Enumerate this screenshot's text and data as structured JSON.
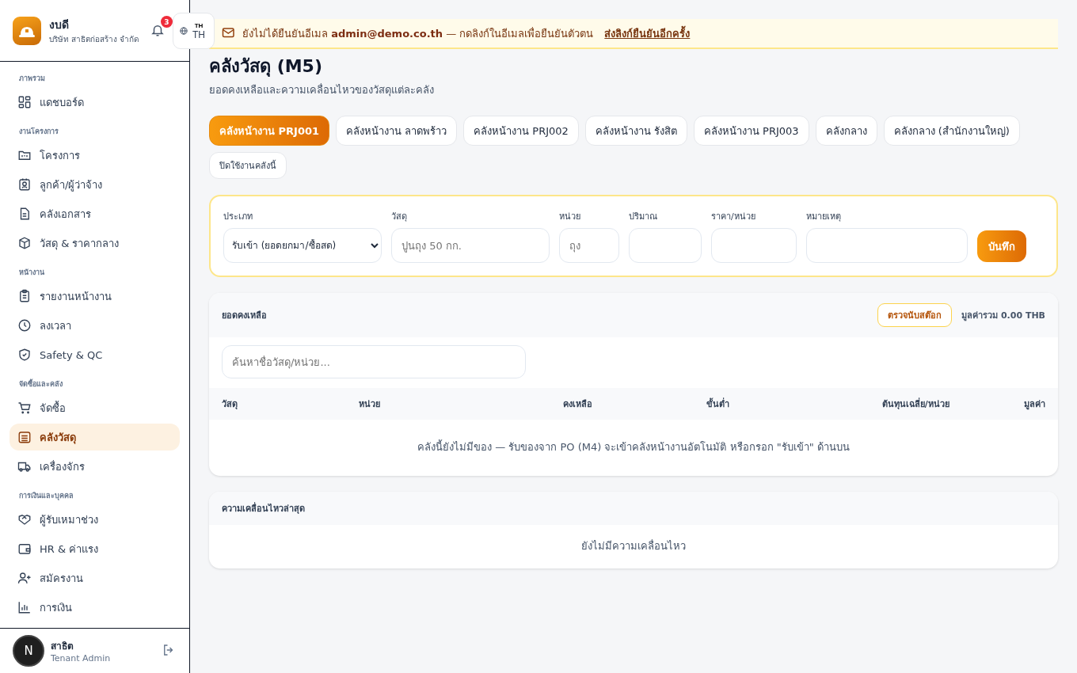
{
  "brand": {
    "name": "งบดี",
    "company": "บริษัท สาธิตก่อสร้าง จำกัด"
  },
  "notifications": {
    "count": "3"
  },
  "language": {
    "small": "TH",
    "label": "TH"
  },
  "sidebar": {
    "sections": [
      {
        "title": "ภาพรวม",
        "items": [
          {
            "label": "แดชบอร์ด",
            "selected": false
          }
        ]
      },
      {
        "title": "งานโครงการ",
        "items": [
          {
            "label": "โครงการ",
            "selected": false
          },
          {
            "label": "ลูกค้า/ผู้ว่าจ้าง",
            "selected": false
          },
          {
            "label": "คลังเอกสาร",
            "selected": false
          },
          {
            "label": "วัสดุ & ราคากลาง",
            "selected": false
          }
        ]
      },
      {
        "title": "หน้างาน",
        "items": [
          {
            "label": "รายงานหน้างาน",
            "selected": false
          },
          {
            "label": "ลงเวลา",
            "selected": false
          },
          {
            "label": "Safety & QC",
            "selected": false
          }
        ]
      },
      {
        "title": "จัดซื้อและคลัง",
        "items": [
          {
            "label": "จัดซื้อ",
            "selected": false
          },
          {
            "label": "คลังวัสดุ",
            "selected": true
          },
          {
            "label": "เครื่องจักร",
            "selected": false
          }
        ]
      },
      {
        "title": "การเงินและบุคคล",
        "items": [
          {
            "label": "ผู้รับเหมาช่วง",
            "selected": false
          },
          {
            "label": "HR & ค่าแรง",
            "selected": false
          },
          {
            "label": "สมัครงาน",
            "selected": false
          },
          {
            "label": "การเงิน",
            "selected": false
          }
        ]
      }
    ]
  },
  "user": {
    "avatar": "N",
    "name": "สาธิต",
    "role": "Tenant Admin"
  },
  "banner": {
    "message": "ยังไม่ได้ยืนยันอีเมล **admin@demo.co.th** — กดลิงก์ในอีเมลเพื่อยืนยันตัวตน",
    "link": "ส่งลิงก์ยืนยันอีกครั้ง"
  },
  "page": {
    "title": "คลังวัสดุ (M5)",
    "subtitle": "ยอดคงเหลือและความเคลื่อนไหวของวัสดุแต่ละคลัง"
  },
  "warehouses": [
    {
      "label": "คลังหน้างาน PRJ001",
      "selected": true
    },
    {
      "label": "คลังหน้างาน ลาดพร้าว",
      "selected": false
    },
    {
      "label": "คลังหน้างาน PRJ002",
      "selected": false
    },
    {
      "label": "คลังหน้างาน รังสิต",
      "selected": false
    },
    {
      "label": "คลังหน้างาน PRJ003",
      "selected": false
    },
    {
      "label": "คลังกลาง",
      "selected": false
    },
    {
      "label": "คลังกลาง (สำนักงานใหญ่)",
      "selected": false
    }
  ],
  "disable_button": "ปิดใช้งานคลังนี้",
  "entry_form": {
    "fields": [
      {
        "kind": "select",
        "label": "ประเภท",
        "value": "รับเข้า (ยอดยกมา/ซื้อสด)"
      },
      {
        "kind": "input",
        "label": "วัสดุ",
        "placeholder": "ปูนถุง 50 กก."
      },
      {
        "kind": "input",
        "label": "หน่วย",
        "placeholder": "ถุง"
      },
      {
        "kind": "input",
        "label": "ปริมาณ"
      },
      {
        "kind": "input",
        "label": "ราคา/หน่วย"
      },
      {
        "kind": "input",
        "label": "หมายเหตุ"
      }
    ],
    "save_button": "บันทึก"
  },
  "stock": {
    "title": "ยอดคงเหลือ",
    "count_button": "ตรวจนับสต๊อก",
    "total": "มูลค่ารวม 0.00 THB",
    "search": {
      "placeholder": "ค้นหาชื่อวัสดุ/หน่วย..."
    },
    "columns": [
      "วัสดุ",
      "หน่วย",
      "คงเหลือ",
      "ขั้นต่ำ",
      "ต้นทุนเฉลี่ย/หน่วย",
      "มูลค่า"
    ],
    "empty": "คลังนี้ยังไม่มีของ — รับของจาก PO (M4) จะเข้าคลังหน้างานอัตโนมัติ หรือกรอก \"รับเข้า\" ด้านบน"
  },
  "movements": {
    "title": "ความเคลื่อนไหวล่าสุด",
    "empty": "ยังไม่มีความเคลื่อนไหว"
  }
}
